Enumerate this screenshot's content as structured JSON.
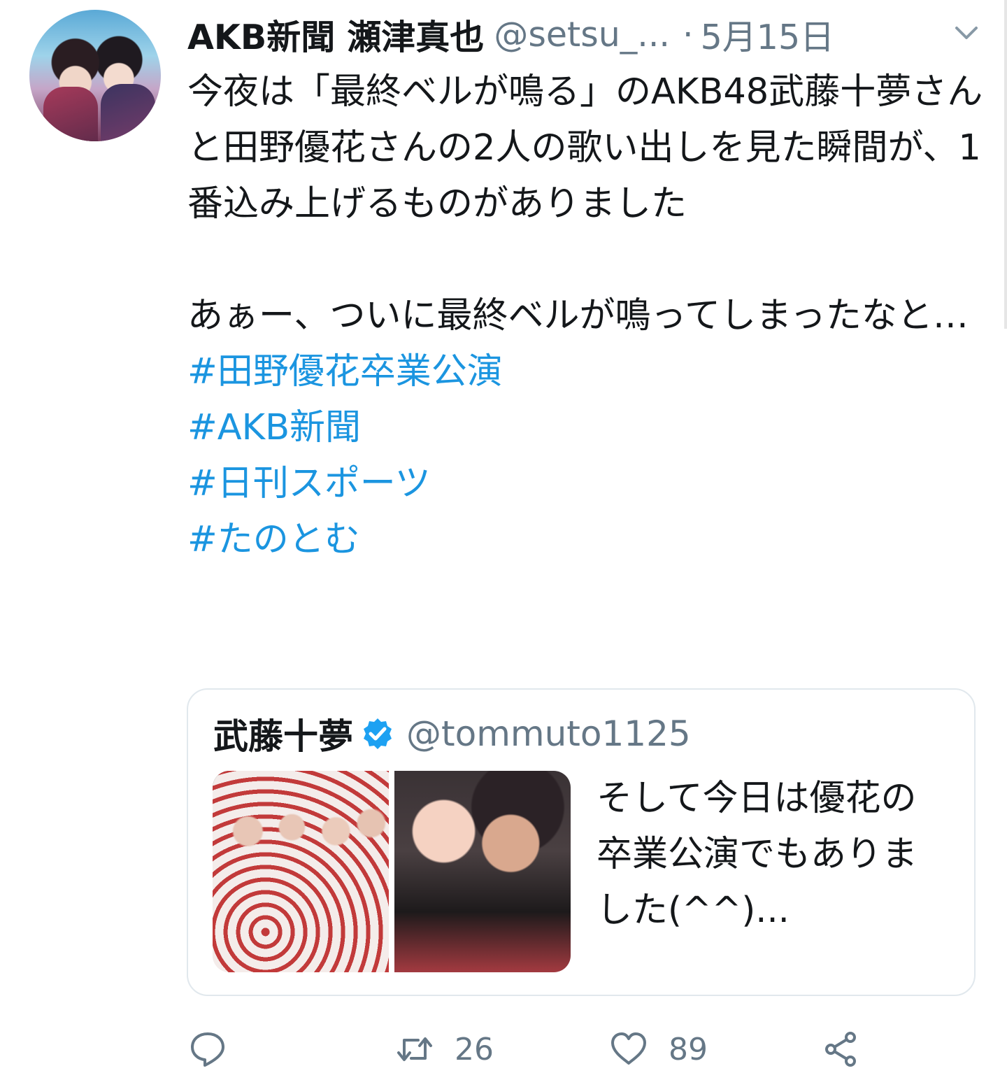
{
  "tweet": {
    "author_name": "AKB新聞 瀬津真也",
    "author_handle": "@setsu_...",
    "separator": "·",
    "date": "5月15日",
    "body": {
      "para1": "今夜は「最終ベルが鳴る」のAKB48武藤十夢さんと田野優花さんの2人の歌い出しを見た瞬間が、1番込み上げるものがありました",
      "para2": "あぁー、ついに最終ベルが鳴ってしまったなと…"
    },
    "hashtags": [
      "#田野優花卒業公演",
      "#AKB新聞",
      "#日刊スポーツ",
      "#たのとむ"
    ]
  },
  "quoted_tweet": {
    "author_name": "武藤十夢",
    "author_handle": "@tommuto1125",
    "text": "そして今日は優花の卒業公演でもありました(^^)..."
  },
  "actions": {
    "reply_count": "",
    "retweet_count": "26",
    "like_count": "89"
  },
  "colors": {
    "hashtag": "#1b95e0",
    "secondary_text": "#657786",
    "verified": "#1da1f2"
  }
}
